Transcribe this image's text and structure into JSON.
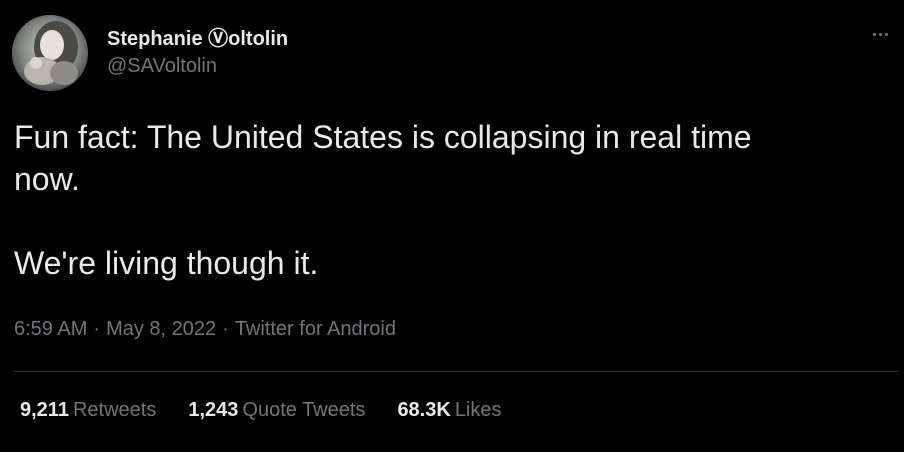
{
  "tweet": {
    "author": {
      "display_name": "Stephanie Ⓥoltolin",
      "handle": "@SAVoltolin"
    },
    "text_line1": "Fun fact: The United States is collapsing in real time\nnow.",
    "text_line2": "We're living though it.",
    "time": "6:59 AM",
    "date": "May 8, 2022",
    "source": "Twitter for Android",
    "separator": "·",
    "stats": [
      {
        "count": "9,211",
        "label": "Retweets"
      },
      {
        "count": "1,243",
        "label": "Quote Tweets"
      },
      {
        "count": "68.3K",
        "label": "Likes"
      }
    ]
  },
  "colors": {
    "background": "#000000",
    "primary_text": "#e7e9ea",
    "secondary_text": "#71767b",
    "divider": "#2f3336"
  },
  "icons": {
    "more": "more-horizontal-icon"
  }
}
